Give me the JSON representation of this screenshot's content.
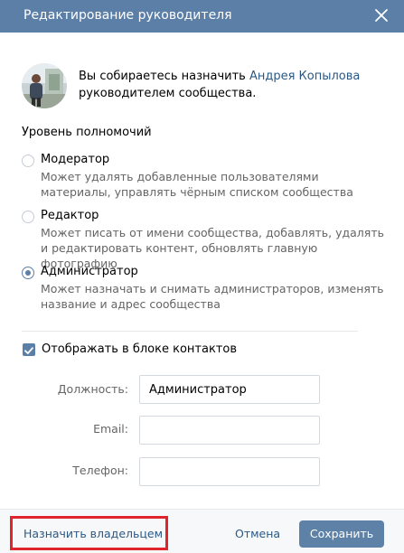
{
  "dialog": {
    "title": "Редактирование руководителя"
  },
  "intro": {
    "text_before": "Вы собираетесь назначить ",
    "user_name": "Андрея Копылова",
    "text_after": "руководителем сообщества."
  },
  "permissions": {
    "title": "Уровень полномочий",
    "options": [
      {
        "label": "Модератор",
        "description": "Может удалять добавленные пользователями материалы, управлять чёрным списком сообщества",
        "checked": false
      },
      {
        "label": "Редактор",
        "description": "Может писать от имени сообщества, добавлять, удалять и редактировать контент, обновлять главную фотографию",
        "checked": false
      },
      {
        "label": "Администратор",
        "description": "Может назначать и снимать администраторов, изменять название и адрес сообщества",
        "checked": true
      }
    ]
  },
  "contacts": {
    "checkbox_label": "Отображать в блоке контактов",
    "checked": true,
    "fields": [
      {
        "label": "Должность:",
        "value": "Администратор",
        "placeholder": ""
      },
      {
        "label": "Email:",
        "value": "",
        "placeholder": ""
      },
      {
        "label": "Телефон:",
        "value": "",
        "placeholder": ""
      }
    ]
  },
  "footer": {
    "owner_link": "Назначить владельцем",
    "cancel": "Отмена",
    "save": "Сохранить"
  },
  "colors": {
    "header": "#5b7fa6",
    "link": "#2a5885",
    "highlight": "#e0242b"
  }
}
